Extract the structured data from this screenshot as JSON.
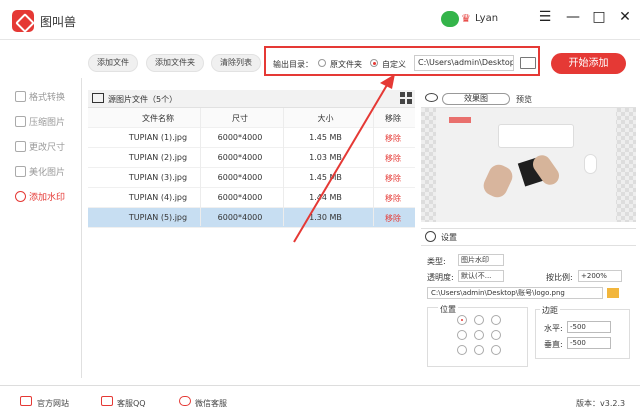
{
  "app": {
    "title": "图叫兽",
    "user": "Lyan"
  },
  "window_controls": {
    "menu": "☰",
    "minimize": "—",
    "maximize": "□",
    "close": "✕"
  },
  "toolbar": {
    "add_file": "添加文件",
    "add_folder": "添加文件夹",
    "clear_list": "清除列表",
    "output_label": "输出目录：",
    "option_original": "原文件夹",
    "option_custom": "自定义",
    "selected_option": "自定义",
    "output_path": "C:\\Users\\admin\\Desktop",
    "start_button": "开始添加"
  },
  "sidebar": {
    "items": [
      {
        "label": "格式转换",
        "active": false
      },
      {
        "label": "压缩图片",
        "active": false
      },
      {
        "label": "更改尺寸",
        "active": false
      },
      {
        "label": "美化图片",
        "active": false
      },
      {
        "label": "添加水印",
        "active": true
      }
    ]
  },
  "source_list": {
    "title": "源图片文件（5个）",
    "columns": [
      "文件名称",
      "尺寸",
      "大小",
      "移除"
    ],
    "rows": [
      {
        "name": "TUPIAN (1).jpg",
        "size": "6000*4000",
        "filesize": "1.45 MB",
        "remove": "移除"
      },
      {
        "name": "TUPIAN (2).jpg",
        "size": "6000*4000",
        "filesize": "1.03 MB",
        "remove": "移除"
      },
      {
        "name": "TUPIAN (3).jpg",
        "size": "6000*4000",
        "filesize": "1.45 MB",
        "remove": "移除"
      },
      {
        "name": "TUPIAN (4).jpg",
        "size": "6000*4000",
        "filesize": "1.44 MB",
        "remove": "移除"
      },
      {
        "name": "TUPIAN (5).jpg",
        "size": "6000*4000",
        "filesize": "1.30 MB",
        "remove": "移除",
        "selected": true
      }
    ]
  },
  "preview": {
    "mode": "效果图",
    "label": "预览"
  },
  "settings": {
    "title": "设置",
    "type_label": "类型:",
    "type_value": "图片水印",
    "opacity_label": "透明度:",
    "opacity_value": "默认(不...",
    "scale_label": "按比例:",
    "scale_value": "+200%",
    "file_path": "C:\\Users\\admin\\Desktop\\账号\\logo.png",
    "position_label": "位置",
    "margin_label": "边距",
    "horizontal_label": "水平:",
    "horizontal_value": "-500",
    "vertical_label": "垂直:",
    "vertical_value": "-500"
  },
  "statusbar": {
    "official_site": "官方网站",
    "qq_support": "客服QQ",
    "wechat_support": "微信客服",
    "version": "版本：v3.2.3"
  }
}
